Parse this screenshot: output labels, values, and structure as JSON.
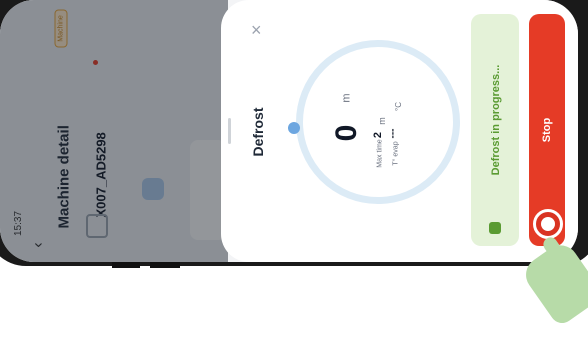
{
  "status_bar": {
    "time": "15:37"
  },
  "header": {
    "title": "Machine detail",
    "machine_id": "X007_AD5298",
    "badge": "Machine"
  },
  "sheet": {
    "title": "Defrost",
    "close_glyph": "×",
    "timer": {
      "value": "0",
      "unit": "m",
      "max_time_label": "Max time",
      "max_time_value": "2",
      "max_time_unit": "m",
      "temp_label": "T° evap",
      "temp_value": "---",
      "temp_unit": "°C"
    },
    "progress_text": "Defrost in progress...",
    "stop_label": "Stop"
  },
  "colors": {
    "stop": "#e53b26",
    "progress_bg": "#e4f2d8",
    "progress_text": "#5a9b32",
    "ring": "#dcebf6",
    "ring_dot": "#6ca6e0"
  },
  "icons": [
    "close-icon",
    "snowflake-icon",
    "stop-icon",
    "back-chevron-icon",
    "tap-hand-icon"
  ]
}
